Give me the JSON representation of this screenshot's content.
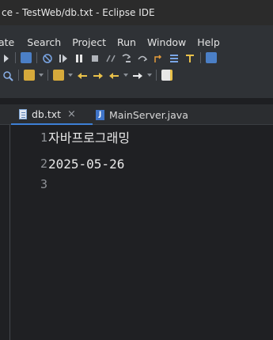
{
  "window": {
    "title": "ce - TestWeb/db.txt - Eclipse IDE"
  },
  "menu": {
    "items": [
      "ate",
      "Search",
      "Project",
      "Run",
      "Window",
      "Help"
    ]
  },
  "toolbar": {
    "row1_icons": [
      "nav-arrow-icon",
      "list-icon",
      "debug-icon",
      "resume-icon",
      "suspend-icon",
      "terminate-icon",
      "disconnect-icon",
      "step-into-icon",
      "step-over-icon",
      "step-return-icon",
      "drop-to-frame-icon",
      "use-step-filters-icon"
    ],
    "row2_icons": [
      "search-icon",
      "open-type-icon",
      "next-annotation-icon",
      "previous-annotation-icon",
      "back-icon",
      "forward-icon"
    ],
    "row3_icons": [
      "new-task-icon"
    ]
  },
  "tabs": [
    {
      "label": "db.txt",
      "icon": "text-file-icon",
      "active": true,
      "close": "×"
    },
    {
      "label": "MainServer.java",
      "icon": "java-file-icon",
      "active": false
    }
  ],
  "editor": {
    "lines": [
      {
        "number": "1",
        "text": "자바프로그래밍"
      },
      {
        "number": "2",
        "text": "2025-05-26"
      },
      {
        "number": "3",
        "text": ""
      }
    ]
  },
  "colors": {
    "background": "#1f2023",
    "chrome": "#2f3236",
    "titlebar": "#2b2b2b",
    "tab_accent": "#3d7fd6",
    "text": "#e8e8e8",
    "line_number": "#8e9196"
  }
}
